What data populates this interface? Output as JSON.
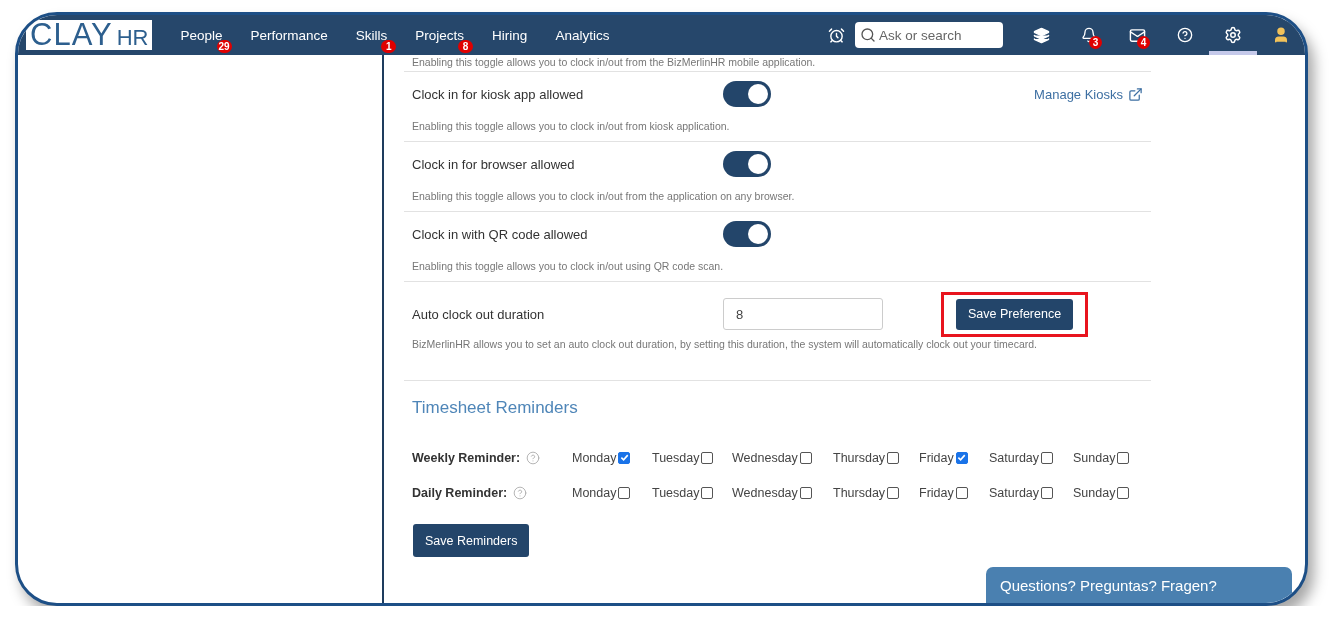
{
  "nav": {
    "logo": {
      "main": "CLAY",
      "suffix": "HR"
    },
    "items": [
      {
        "label": "People",
        "badge": "29"
      },
      {
        "label": "Performance"
      },
      {
        "label": "Skills",
        "badge": "1"
      },
      {
        "label": "Projects",
        "badge": "8"
      },
      {
        "label": "Hiring"
      },
      {
        "label": "Analytics"
      }
    ],
    "search": {
      "placeholder": "Ask or search"
    },
    "icon_buttons": [
      {
        "kind": "layers",
        "selected": false
      },
      {
        "kind": "bell",
        "badge": "3",
        "selected": false
      },
      {
        "kind": "mail",
        "badge": "4",
        "selected": false
      },
      {
        "kind": "help",
        "selected": false
      },
      {
        "kind": "settings",
        "selected": true
      },
      {
        "kind": "avatar",
        "selected": false
      }
    ]
  },
  "settings": {
    "top_note": "Enabling this toggle allows you to clock in/out from the BizMerlinHR mobile application.",
    "toggles": [
      {
        "label": "Clock in for kiosk app allowed",
        "on": true,
        "link": "Manage Kiosks",
        "description": "Enabling this toggle allows you to clock in/out from kiosk application."
      },
      {
        "label": "Clock in for browser allowed",
        "on": true,
        "description": "Enabling this toggle allows you to clock in/out from the application on any browser."
      },
      {
        "label": "Clock in with QR code allowed",
        "on": true,
        "description": "Enabling this toggle allows you to clock in/out using QR code scan."
      }
    ],
    "auto_clock_out": {
      "label": "Auto clock out duration",
      "value": "8",
      "button": "Save Preference",
      "highlighted": true,
      "description": "BizMerlinHR allows you to set an auto clock out duration, by setting this duration, the system will automatically clock out your timecard."
    },
    "reminders": {
      "title": "Timesheet Reminders",
      "rows": [
        {
          "label": "Weekly Reminder:",
          "days": [
            {
              "label": "Monday",
              "checked": true
            },
            {
              "label": "Tuesday",
              "checked": false
            },
            {
              "label": "Wednesday",
              "checked": false
            },
            {
              "label": "Thursday",
              "checked": false
            },
            {
              "label": "Friday",
              "checked": true
            },
            {
              "label": "Saturday",
              "checked": false
            },
            {
              "label": "Sunday",
              "checked": false
            }
          ]
        },
        {
          "label": "Daily Reminder:",
          "days": [
            {
              "label": "Monday",
              "checked": false
            },
            {
              "label": "Tuesday",
              "checked": false
            },
            {
              "label": "Wednesday",
              "checked": false
            },
            {
              "label": "Thursday",
              "checked": false
            },
            {
              "label": "Friday",
              "checked": false
            },
            {
              "label": "Saturday",
              "checked": false
            },
            {
              "label": "Sunday",
              "checked": false
            }
          ]
        }
      ],
      "button": "Save Reminders"
    }
  },
  "help_tab": "Questions? Preguntas? Fragen?"
}
